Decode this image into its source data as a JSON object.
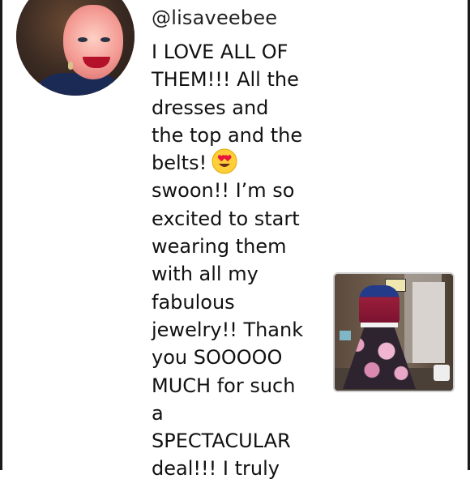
{
  "post": {
    "username": "@lisaveebee",
    "avatar_icon": "profile-avatar-icon",
    "comment_lines": [
      "I LOVE ALL OF",
      "THEM!!! All the",
      "dresses and",
      "the top and the",
      "belts!",
      "swoon!! I’m so",
      "excited to start",
      "wearing them",
      "with all my",
      "fabulous",
      "jewelry!! Thank",
      "you SOOOOO",
      "MUCH for such",
      "a",
      "SPECTACULAR",
      "deal!!! I truly"
    ],
    "emoji_icon": "heart-eyes-emoji-icon",
    "attachment_icon": "dress-photo-thumbnail"
  },
  "colors": {
    "background": "#ffffff",
    "text": "#111111",
    "frame": "#1a1a1a"
  }
}
